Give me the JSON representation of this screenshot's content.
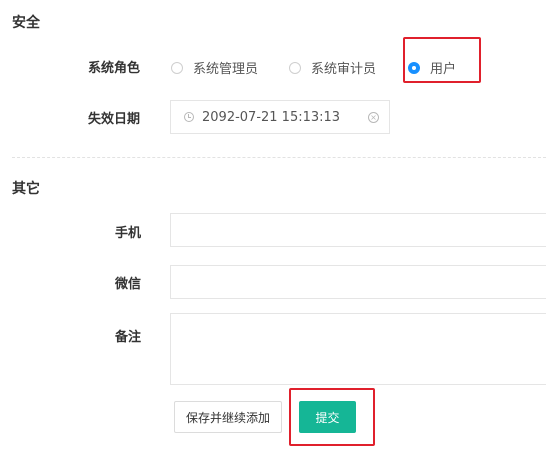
{
  "security": {
    "title": "安全",
    "role": {
      "label": "系统角色",
      "options": [
        {
          "label": "系统管理员",
          "checked": false
        },
        {
          "label": "系统审计员",
          "checked": false
        },
        {
          "label": "用户",
          "checked": true
        }
      ]
    },
    "expiry": {
      "label": "失效日期",
      "value": "2092-07-21 15:13:13",
      "clock_icon": "clock-icon",
      "clear_icon": "clear-icon"
    }
  },
  "other": {
    "title": "其它",
    "phone_label": "手机",
    "phone_value": "",
    "wechat_label": "微信",
    "wechat_value": "",
    "remark_label": "备注",
    "remark_value": ""
  },
  "actions": {
    "save_continue_label": "保存并继续添加",
    "submit_label": "提交"
  },
  "colors": {
    "primary": "#15b696",
    "radio_checked": "#1890ff",
    "highlight": "#e0202c"
  }
}
